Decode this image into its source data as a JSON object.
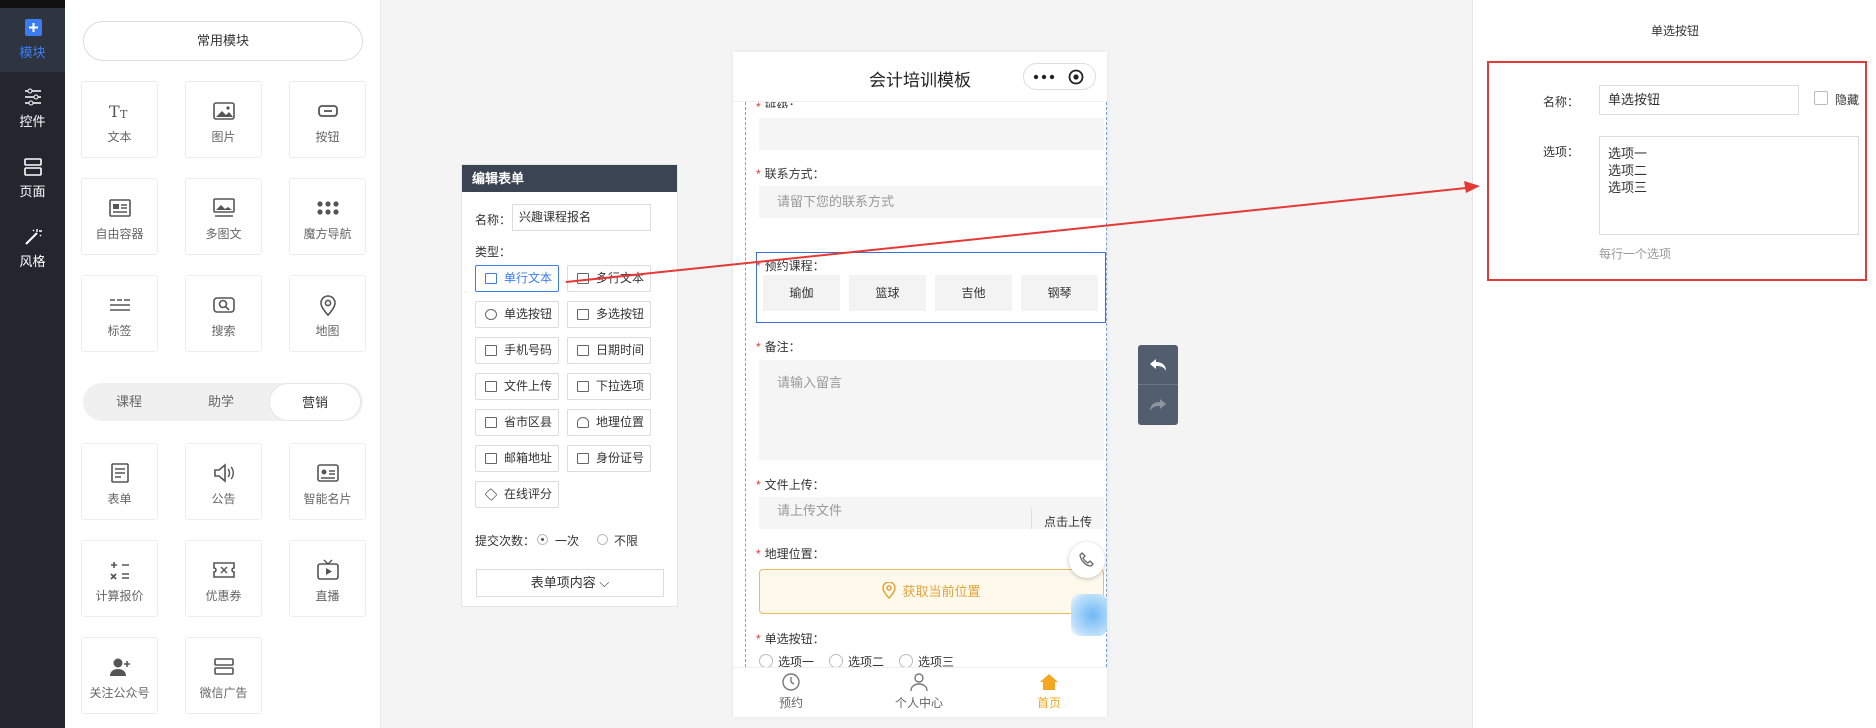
{
  "left_nav": {
    "items": [
      {
        "label": "模块",
        "icon": "plus-square-icon",
        "active": true
      },
      {
        "label": "控件",
        "icon": "sliders-icon"
      },
      {
        "label": "页面",
        "icon": "layout-icon"
      },
      {
        "label": "风格",
        "icon": "magic-wand-icon"
      }
    ]
  },
  "modules": {
    "common_label": "常用模块",
    "common": [
      {
        "label": "文本",
        "icon": "text-icon"
      },
      {
        "label": "图片",
        "icon": "image-icon"
      },
      {
        "label": "按钮",
        "icon": "button-icon"
      },
      {
        "label": "自由容器",
        "icon": "container-icon"
      },
      {
        "label": "多图文",
        "icon": "multi-image-icon"
      },
      {
        "label": "魔方导航",
        "icon": "grid-dots-icon"
      },
      {
        "label": "标签",
        "icon": "tag-icon"
      },
      {
        "label": "搜索",
        "icon": "search-icon"
      },
      {
        "label": "地图",
        "icon": "map-pin-icon"
      }
    ],
    "tabs": [
      {
        "label": "课程"
      },
      {
        "label": "助学"
      },
      {
        "label": "营销",
        "active": true
      }
    ],
    "marketing": [
      {
        "label": "表单",
        "icon": "form-icon"
      },
      {
        "label": "公告",
        "icon": "announcement-icon"
      },
      {
        "label": "智能名片",
        "icon": "card-icon"
      },
      {
        "label": "计算报价",
        "icon": "calculator-icon"
      },
      {
        "label": "优惠券",
        "icon": "coupon-icon"
      },
      {
        "label": "直播",
        "icon": "live-tv-icon"
      },
      {
        "label": "关注公众号",
        "icon": "user-plus-icon"
      },
      {
        "label": "微信广告",
        "icon": "ad-icon"
      }
    ]
  },
  "edit_form": {
    "title": "编辑表单",
    "name_label": "名称：",
    "name_value": "兴趣课程报名",
    "type_label": "类型：",
    "types": [
      {
        "label": "单行文本",
        "selected": true
      },
      {
        "label": "多行文本"
      },
      {
        "label": "单选按钮"
      },
      {
        "label": "多选按钮"
      },
      {
        "label": "手机号码"
      },
      {
        "label": "日期时间"
      },
      {
        "label": "文件上传"
      },
      {
        "label": "下拉选项"
      },
      {
        "label": "省市区县"
      },
      {
        "label": "地理位置"
      },
      {
        "label": "邮箱地址"
      },
      {
        "label": "身份证号"
      },
      {
        "label": "在线评分"
      }
    ],
    "submit_label": "提交次数：",
    "submit_once": "一次",
    "submit_unlimited": "不限",
    "more_button": "表单项内容 ⌵"
  },
  "phone": {
    "title": "会计培训模板",
    "class_label": "班级：",
    "contact_label": "联系方式：",
    "contact_placeholder": "请留下您的联系方式",
    "course_label": "预约课程：",
    "courses": [
      "瑜伽",
      "篮球",
      "吉他",
      "钢琴"
    ],
    "remark_label": "备注：",
    "remark_placeholder": "请输入留言",
    "upload_label": "文件上传：",
    "upload_placeholder": "请上传文件",
    "upload_button": "点击上传",
    "location_label": "地理位置：",
    "location_button": "获取当前位置",
    "radio_label": "单选按钮：",
    "radio_options": [
      "选项一",
      "选项二",
      "选项三"
    ],
    "footer": [
      {
        "label": "预约",
        "icon": "clock-icon"
      },
      {
        "label": "个人中心",
        "icon": "user-icon"
      },
      {
        "label": "首页",
        "icon": "home-icon",
        "active": true
      }
    ]
  },
  "props": {
    "title": "单选按钮",
    "name_label": "名称：",
    "name_value": "单选按钮",
    "hide_label": "隐藏",
    "options_label": "选项：",
    "options": [
      "选项一",
      "选项二",
      "选项三"
    ],
    "options_hint": "每行一个选项"
  },
  "colors": {
    "accent": "#3b7cf5",
    "nav_bg": "#23262e",
    "highlight_red": "#e53935",
    "active_orange": "#f5a623"
  }
}
